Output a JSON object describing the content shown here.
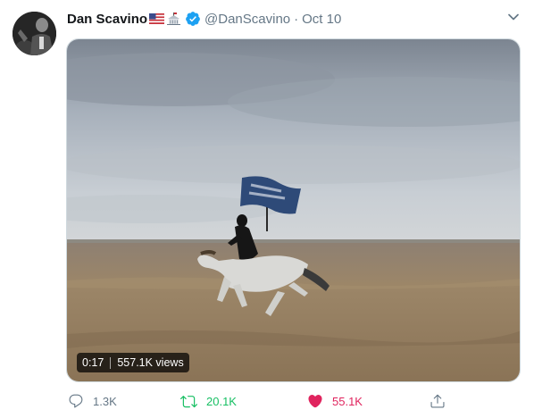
{
  "tweet": {
    "author_name": "Dan Scavino",
    "handle": "@DanScavino",
    "separator": "·",
    "date": "Oct 10",
    "name_emoji_1": "us-flag-emoji",
    "name_emoji_2": "white-house-emoji"
  },
  "media": {
    "duration": "0:17",
    "views": "557.1K views"
  },
  "actions": {
    "reply_count": "1.3K",
    "retweet_count": "20.1K",
    "like_count": "55.1K",
    "liked": true,
    "retweeted": true
  },
  "colors": {
    "text_primary": "#14171a",
    "text_secondary": "#657786",
    "verified": "#1da1f2",
    "retweet_green": "#17bf63",
    "like_pink": "#e0245e"
  },
  "icons": [
    "verified-badge-icon",
    "chevron-down-icon",
    "reply-icon",
    "retweet-icon",
    "heart-icon",
    "share-icon"
  ]
}
